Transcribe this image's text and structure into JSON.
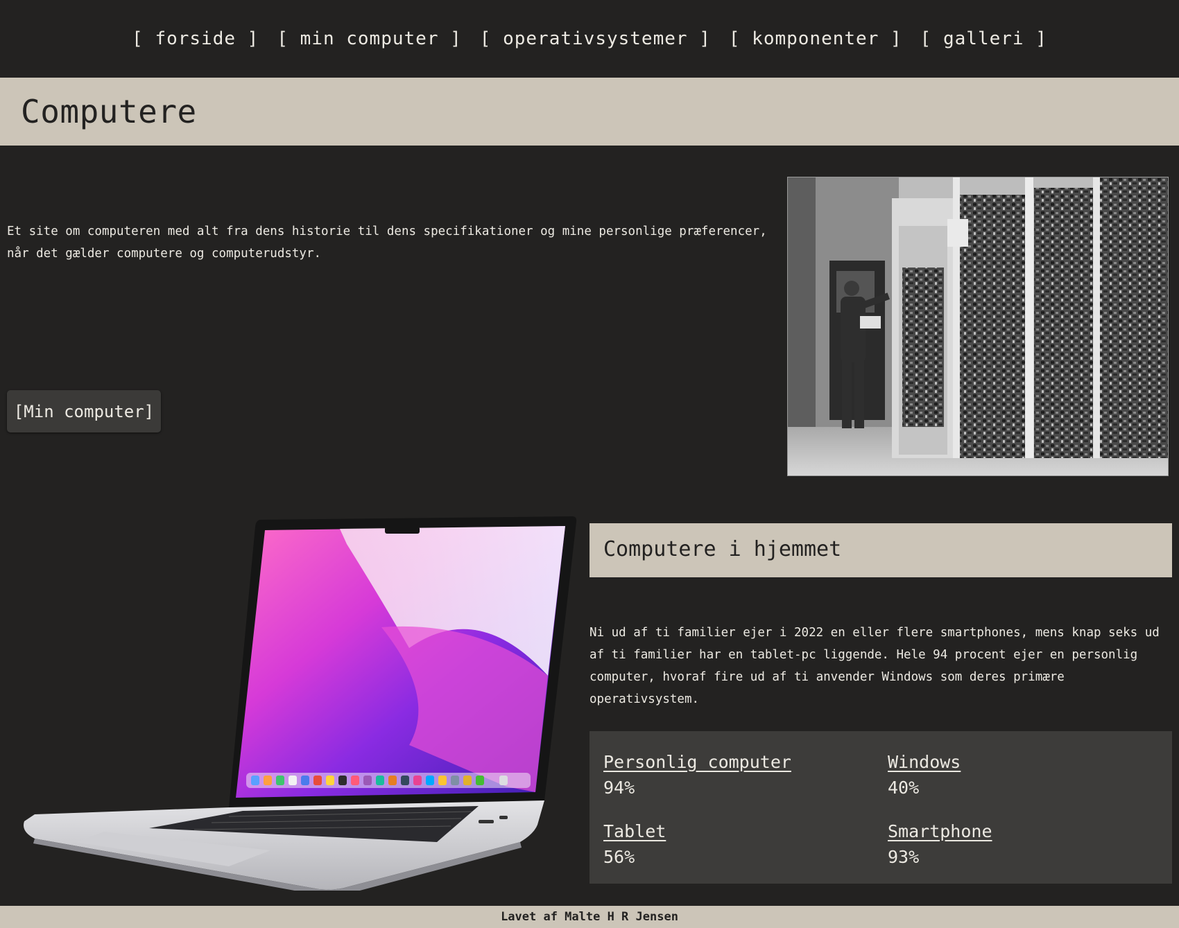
{
  "nav": {
    "items": [
      {
        "label": "[ forside ]"
      },
      {
        "label": "[ min computer ]"
      },
      {
        "label": "[ operativsystemer ]"
      },
      {
        "label": "[ komponenter ]"
      },
      {
        "label": "[ galleri ]"
      }
    ]
  },
  "hero": {
    "title": "Computere",
    "intro": "Et site om computeren med alt fra dens historie til dens specifikationer og mine personlige præferencer, når det gælder computere og computerudstyr.",
    "button_label": "[Min computer]"
  },
  "home_section": {
    "title": "Computere i hjemmet",
    "text": "Ni ud af ti familier ejer i 2022 en eller flere smartphones, mens knap seks ud af ti familier har en tablet-pc liggende. Hele 94 procent ejer en personlig computer, hvoraf fire ud af ti anvender Windows som deres primære operativsystem.",
    "stats": [
      {
        "label": "Personlig computer",
        "value": "94%"
      },
      {
        "label": "Windows",
        "value": "40%"
      },
      {
        "label": "Tablet",
        "value": "56%"
      },
      {
        "label": "Smartphone",
        "value": "93%"
      }
    ]
  },
  "footer": {
    "text": "Lavet af Malte H R Jensen"
  },
  "colors": {
    "background": "#232221",
    "band": "#ccc5b8",
    "stats_panel": "#3d3c3a",
    "button": "#3b3a38",
    "text_light": "#ece9e2"
  }
}
